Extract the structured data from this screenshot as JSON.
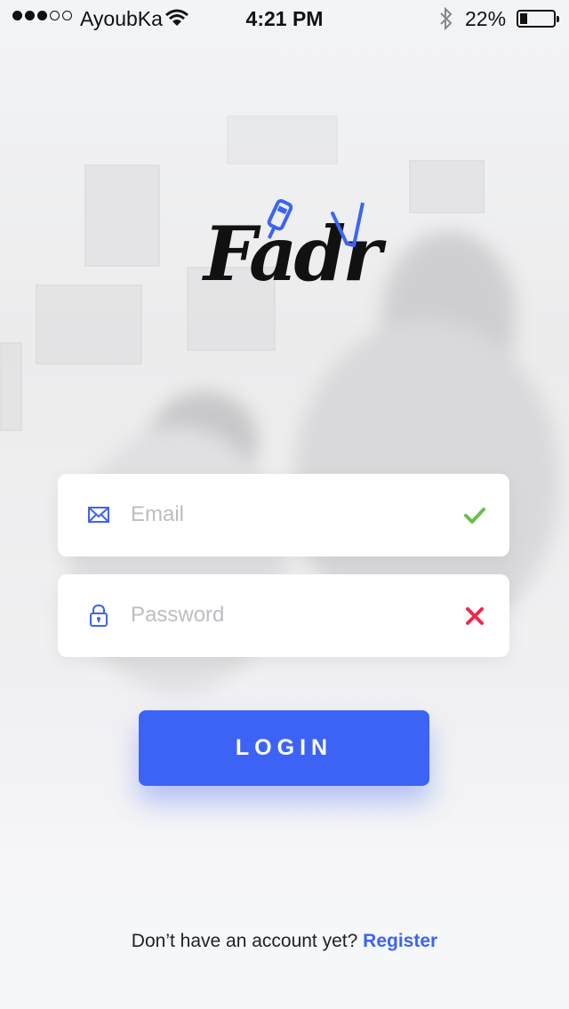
{
  "status_bar": {
    "carrier": "AyoubKa",
    "time": "4:21 PM",
    "battery": "22%",
    "signal_full": 3,
    "signal_empty": 2
  },
  "logo": {
    "text": "Fadr"
  },
  "form": {
    "email": {
      "placeholder": "Email",
      "value": "",
      "icon": "mail-icon",
      "status": "valid",
      "status_icon": "check-icon",
      "status_color": "#6cc04a"
    },
    "password": {
      "placeholder": "Password",
      "value": "",
      "icon": "lock-icon",
      "status": "invalid",
      "status_icon": "cross-icon",
      "status_color": "#f0284a"
    },
    "login_label": "LOGIN"
  },
  "footer": {
    "prompt": "Don’t have an account yet?",
    "register_label": "Register"
  },
  "colors": {
    "accent": "#3d63f6",
    "valid": "#6cc04a",
    "invalid": "#f0284a"
  }
}
